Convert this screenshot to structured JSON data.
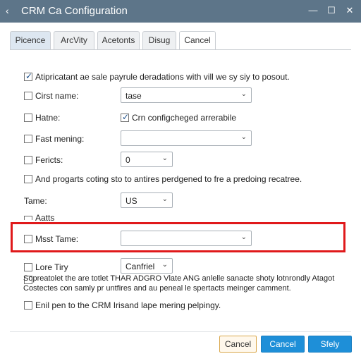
{
  "window": {
    "back": "‹",
    "title": "CRM Ca Configuration",
    "minimize": "—",
    "maximize": "☐",
    "close": "✕"
  },
  "tabs": [
    "Picence",
    "ArcVity",
    "Acetonts",
    "Disug",
    "Cancel"
  ],
  "rows": {
    "r1": {
      "label": "Atipricatant ae sale payrule deradations with vill we sy siy to posout.",
      "checked": true
    },
    "r2": {
      "label": "Cirst name:",
      "select": "tase"
    },
    "r3": {
      "label": "Hatne:",
      "checkbox2_label": "Crn configcheged arrerabile",
      "checkbox2_checked": true
    },
    "r4": {
      "label": "Fast mening:",
      "select": ""
    },
    "r5": {
      "label": "Fericts:",
      "select": "0"
    },
    "r6": {
      "label": "And progarts coting sto to antires perdgened to fre a predoing recatree."
    },
    "r7": {
      "label": "Tame:",
      "select": "US"
    },
    "r8": {
      "label": "Aatts"
    },
    "r9": {
      "label": "Msst Tame:",
      "select": ""
    },
    "r10": {
      "label": "Lore Tiry",
      "select": "Canfriel"
    },
    "r11": {
      "label": "Sopreatolet the are totlet THAR ADGRO Vlate ANG anlelle sanacte shoty lotnrondly Atagot",
      "label2": "Costectes con samly pr untfires and au peneal le spertacts meinger camment."
    },
    "r12": {
      "label": "Enil pen to the CRM Irisand lape mering pelpingy."
    }
  },
  "buttons": {
    "cancel1": "Cancel",
    "cancel2": "Cancel",
    "apply": "Sfely"
  }
}
